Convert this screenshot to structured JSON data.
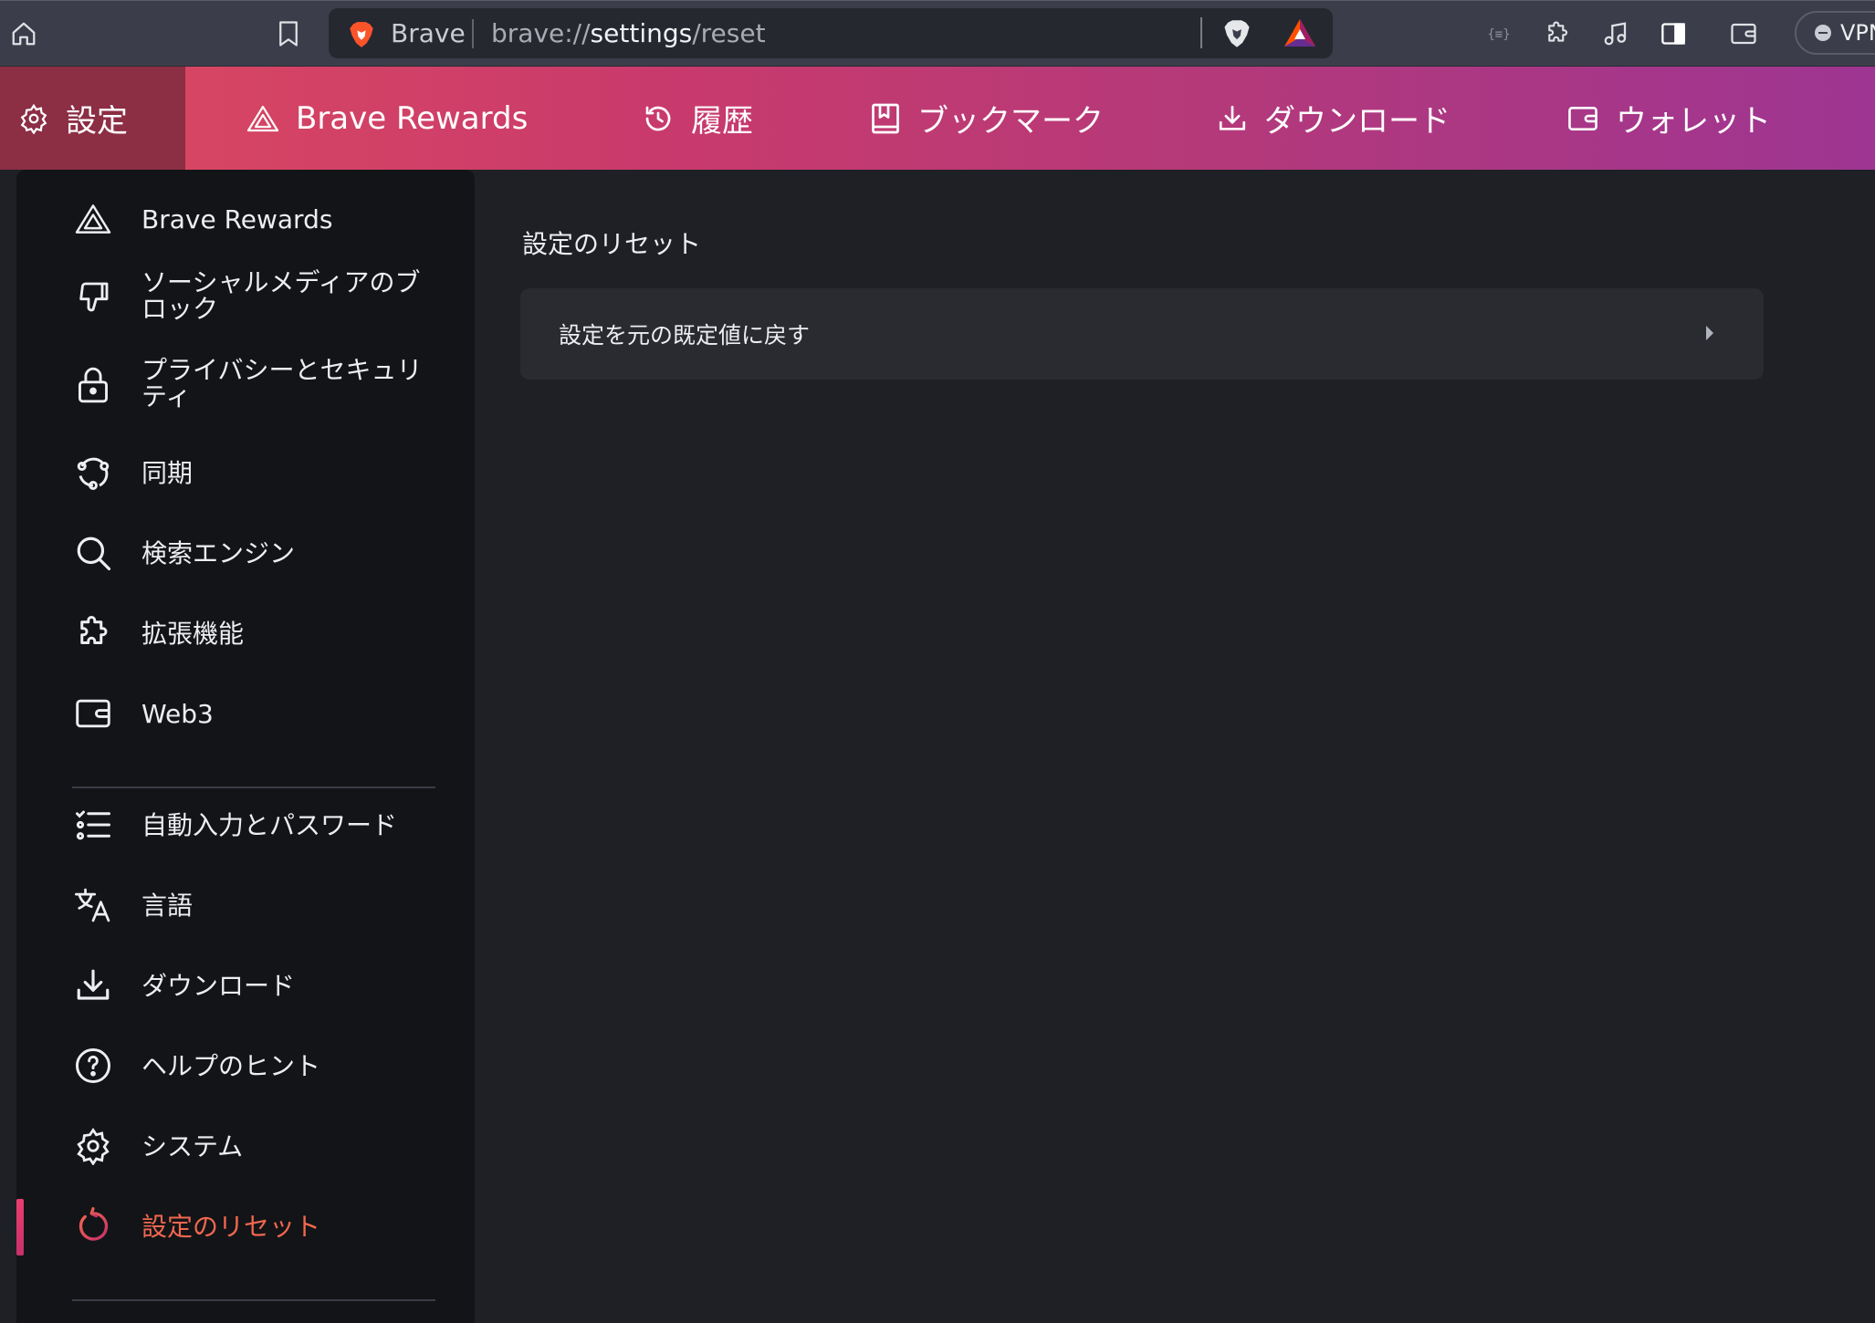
{
  "toolbar": {
    "omnibox": {
      "brand": "Brave",
      "url_prefix": "brave://",
      "url_host": "settings",
      "url_path": "/reset"
    },
    "vpn_label": "VPN"
  },
  "header": {
    "items": [
      {
        "label": "設定",
        "icon": "gear-icon",
        "active": true
      },
      {
        "label": "Brave Rewards",
        "icon": "bat-triangle-icon"
      },
      {
        "label": "履歴",
        "icon": "history-icon"
      },
      {
        "label": "ブックマーク",
        "icon": "bookmark-book-icon"
      },
      {
        "label": "ダウンロード",
        "icon": "download-icon"
      },
      {
        "label": "ウォレット",
        "icon": "wallet-icon"
      }
    ]
  },
  "sidebar": {
    "items": [
      {
        "label": "Brave Rewards",
        "icon": "bat-triangle-icon"
      },
      {
        "label": "ソーシャルメディアのブロック",
        "icon": "thumbs-down-icon"
      },
      {
        "label": "プライバシーとセキュリティ",
        "icon": "lock-icon"
      },
      {
        "label": "同期",
        "icon": "sync-icon"
      },
      {
        "label": "検索エンジン",
        "icon": "search-icon"
      },
      {
        "label": "拡張機能",
        "icon": "puzzle-icon"
      },
      {
        "label": "Web3",
        "icon": "wallet-icon"
      },
      {
        "label": "自動入力とパスワード",
        "icon": "list-icon"
      },
      {
        "label": "言語",
        "icon": "translate-icon"
      },
      {
        "label": "ダウンロード",
        "icon": "download-icon"
      },
      {
        "label": "ヘルプのヒント",
        "icon": "help-icon"
      },
      {
        "label": "システム",
        "icon": "gear-icon"
      },
      {
        "label": "設定のリセット",
        "icon": "reset-icon",
        "active": true
      }
    ]
  },
  "main": {
    "section_title": "設定のリセット",
    "card_label": "設定を元の既定値に戻す"
  },
  "colors": {
    "accent_text": "#f0684f",
    "active_bar": "#e93e6e",
    "gradient_start": "#dc4a5f",
    "gradient_end": "#9e3592"
  }
}
